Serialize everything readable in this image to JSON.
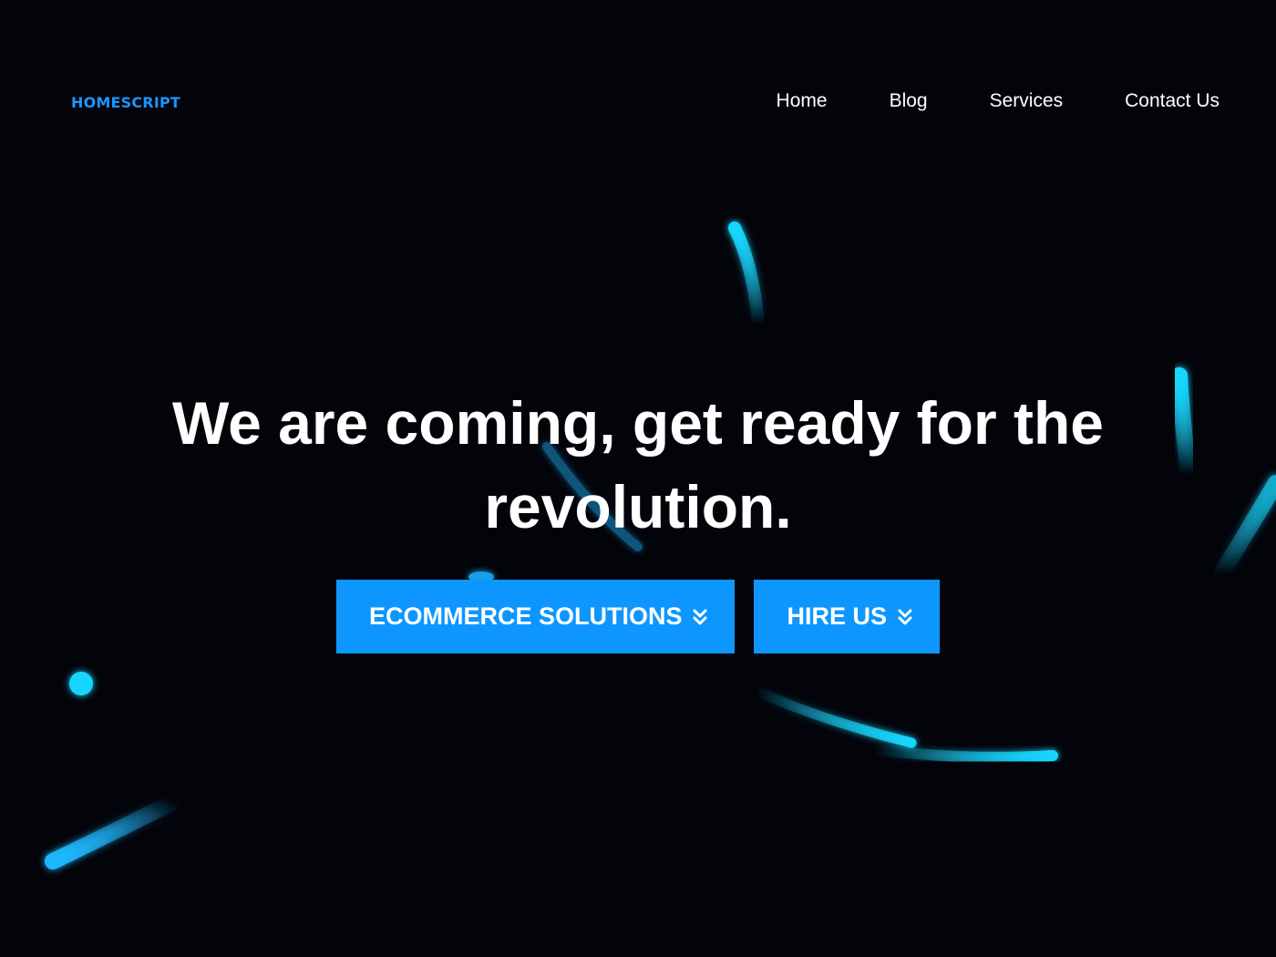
{
  "brand": {
    "logo_text": "HOMESCRIPT",
    "accent_color": "#1c95ff"
  },
  "nav": {
    "items": [
      {
        "label": "Home"
      },
      {
        "label": "Blog"
      },
      {
        "label": "Services"
      },
      {
        "label": "Contact Us"
      }
    ]
  },
  "hero": {
    "title": "We are coming, get ready for the revolution.",
    "buttons": [
      {
        "label": "ECOMMERCE SOLUTIONS",
        "icon": "double-chevron-down-icon"
      },
      {
        "label": "HIRE US",
        "icon": "double-chevron-down-icon"
      }
    ],
    "button_color": "#0e96ff"
  },
  "background": {
    "color": "#03030a",
    "particle_color": "#19d6ff"
  }
}
